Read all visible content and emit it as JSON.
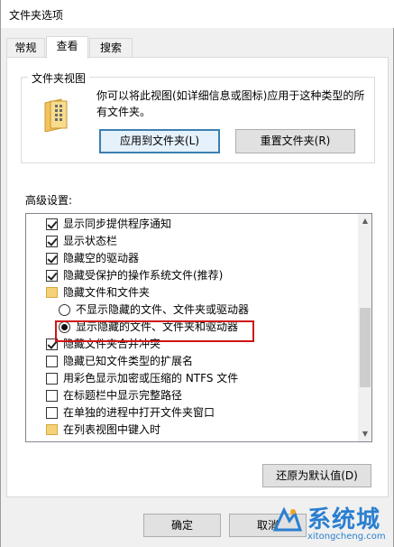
{
  "window": {
    "title": "文件夹选项"
  },
  "tabs": [
    {
      "label": "常规",
      "active": false
    },
    {
      "label": "查看",
      "active": true
    },
    {
      "label": "搜索",
      "active": false
    }
  ],
  "folder_view": {
    "title": "文件夹视图",
    "description": "你可以将此视图(如详细信息或图标)应用于这种类型的所有文件夹。",
    "apply_button": "应用到文件夹(L)",
    "reset_button": "重置文件夹(R)"
  },
  "advanced": {
    "label": "高级设置:",
    "items": [
      {
        "type": "checkbox",
        "checked": true,
        "indent": 1,
        "label": "显示同步提供程序通知"
      },
      {
        "type": "checkbox",
        "checked": true,
        "indent": 1,
        "label": "显示状态栏"
      },
      {
        "type": "checkbox",
        "checked": true,
        "indent": 1,
        "label": "隐藏空的驱动器"
      },
      {
        "type": "checkbox",
        "checked": true,
        "indent": 1,
        "label": "隐藏受保护的操作系统文件(推荐)"
      },
      {
        "type": "folder",
        "checked": false,
        "indent": 1,
        "label": "隐藏文件和文件夹"
      },
      {
        "type": "radio",
        "checked": false,
        "indent": 2,
        "label": "不显示隐藏的文件、文件夹或驱动器"
      },
      {
        "type": "radio",
        "checked": true,
        "indent": 2,
        "label": "显示隐藏的文件、文件夹和驱动器"
      },
      {
        "type": "checkbox",
        "checked": true,
        "indent": 1,
        "label": "隐藏文件夹合并冲突"
      },
      {
        "type": "checkbox",
        "checked": false,
        "indent": 1,
        "label": "隐藏已知文件类型的扩展名"
      },
      {
        "type": "checkbox",
        "checked": false,
        "indent": 1,
        "label": "用彩色显示加密或压缩的 NTFS 文件"
      },
      {
        "type": "checkbox",
        "checked": false,
        "indent": 1,
        "label": "在标题栏中显示完整路径"
      },
      {
        "type": "checkbox",
        "checked": false,
        "indent": 1,
        "label": "在单独的进程中打开文件夹窗口"
      },
      {
        "type": "folder",
        "checked": false,
        "indent": 1,
        "label": "在列表视图中键入时"
      }
    ],
    "restore_button": "还原为默认值(D)"
  },
  "footer": {
    "ok_button": "确定",
    "cancel_button": "取消"
  },
  "watermark": {
    "name": "系统城",
    "url": "xitongcheng.com"
  },
  "colors": {
    "highlight": "#d01414",
    "focus_border": "#3c7fb1",
    "watermark": "#2a7fd0"
  }
}
